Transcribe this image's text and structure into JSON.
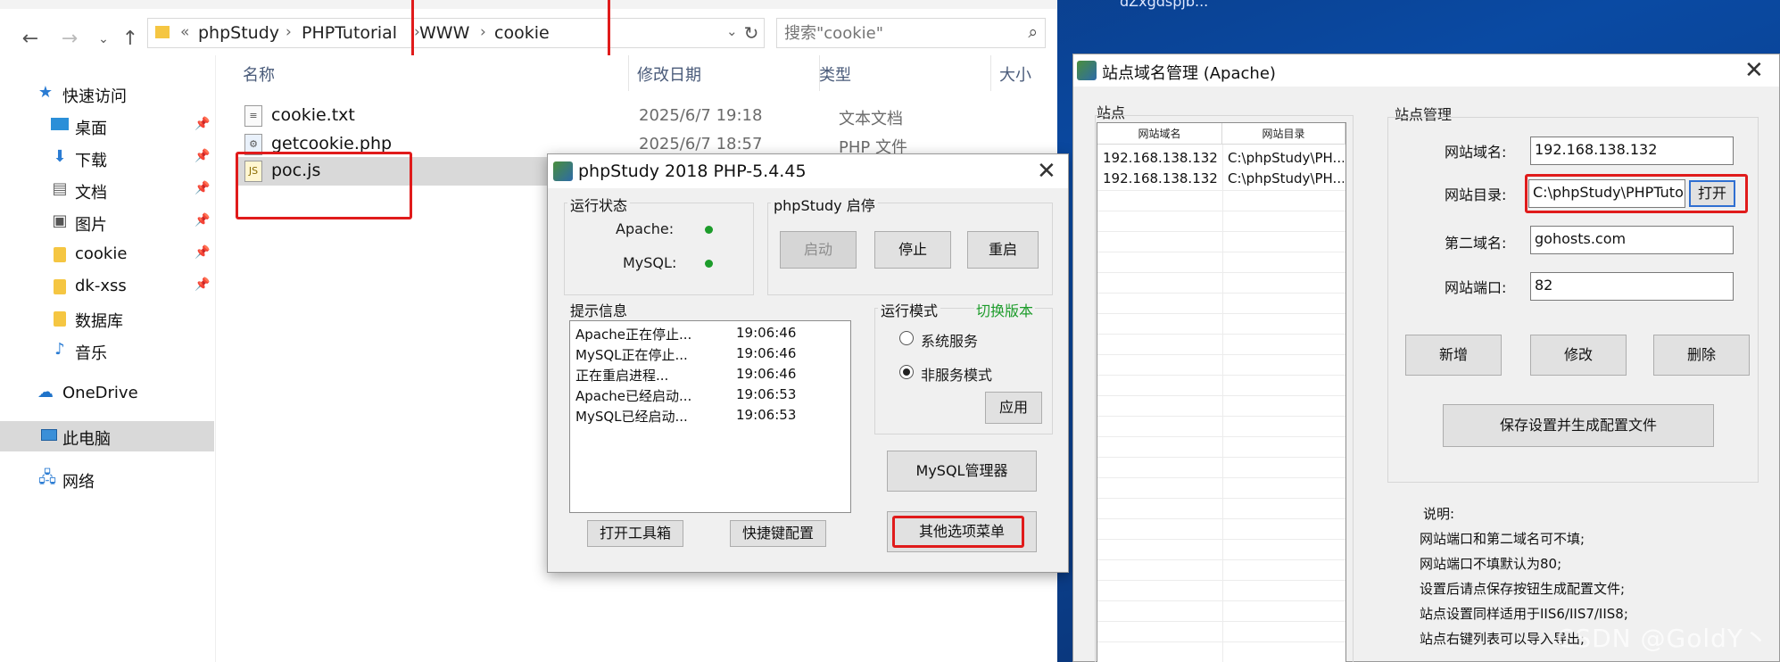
{
  "explorer": {
    "address": {
      "overflow": "«",
      "crumbs": [
        "phpStudy",
        "PHPTutorial",
        "WWW",
        "cookie"
      ]
    },
    "search_placeholder": "搜索\"cookie\"",
    "sidebar": [
      {
        "label": "快速访问",
        "icon": "star-icon",
        "pinned": false
      },
      {
        "label": "桌面",
        "icon": "desktop-icon",
        "pinned": true
      },
      {
        "label": "下载",
        "icon": "download-icon",
        "pinned": true
      },
      {
        "label": "文档",
        "icon": "document-icon",
        "pinned": true
      },
      {
        "label": "图片",
        "icon": "picture-icon",
        "pinned": true
      },
      {
        "label": "cookie",
        "icon": "folder-icon",
        "pinned": true
      },
      {
        "label": "dk-xss",
        "icon": "folder-icon",
        "pinned": true
      },
      {
        "label": "数据库",
        "icon": "folder-icon",
        "pinned": false
      },
      {
        "label": "音乐",
        "icon": "music-icon",
        "pinned": false
      },
      {
        "label": "OneDrive",
        "icon": "cloud-icon",
        "pinned": false
      },
      {
        "label": "此电脑",
        "icon": "computer-icon",
        "pinned": false
      },
      {
        "label": "网络",
        "icon": "network-icon",
        "pinned": false
      }
    ],
    "columns": {
      "name": "名称",
      "date": "修改日期",
      "type": "类型",
      "size": "大小"
    },
    "files": [
      {
        "name": "cookie.txt",
        "date": "2025/6/7 19:18",
        "type": "文本文档",
        "icon": "text-file-icon"
      },
      {
        "name": "getcookie.php",
        "date": "2025/6/7 18:57",
        "type": "PHP 文件",
        "icon": "php-file-icon"
      },
      {
        "name": "poc.js",
        "date": "",
        "type": "",
        "icon": "js-file-icon"
      }
    ]
  },
  "phpstudy": {
    "title": "phpStudy 2018   PHP-5.4.45",
    "status_group": "运行状态",
    "apache_label": "Apache:",
    "mysql_label": "MySQL:",
    "control_group": "phpStudy  启停",
    "start_label": "启动",
    "stop_label": "停止",
    "restart_label": "重启",
    "info_group": "提示信息",
    "info_lines": [
      {
        "text": "Apache正在停止...",
        "time": "19:06:46"
      },
      {
        "text": "MySQL正在停止...",
        "time": "19:06:46"
      },
      {
        "text": "正在重启进程...",
        "time": "19:06:46"
      },
      {
        "text": "Apache已经启动...",
        "time": "19:06:53"
      },
      {
        "text": "MySQL已经启动...",
        "time": "19:06:53"
      }
    ],
    "mode_group": "运行模式",
    "switch_version": "切换版本",
    "mode_system": "系统服务",
    "mode_non_system": "非服务模式",
    "apply_label": "应用",
    "mysql_manager_label": "MySQL管理器",
    "open_tools_label": "打开工具箱",
    "shortcut_label": "快捷键配置",
    "other_menu_label": "其他选项菜单",
    "status_color": "#1d9c2b"
  },
  "sitemgr": {
    "title": "站点域名管理 (Apache)",
    "sites_group": "站点",
    "col_domain": "网站域名",
    "col_dir": "网站目录",
    "rows": [
      {
        "domain": "192.168.138.132",
        "dir": "C:\\phpStudy\\PH..."
      },
      {
        "domain": "192.168.138.132",
        "dir": "C:\\phpStudy\\PH..."
      }
    ],
    "manage_group": "站点管理",
    "domain_label": "网站域名:",
    "domain_value": "192.168.138.132",
    "dir_label": "网站目录:",
    "dir_value": "C:\\phpStudy\\PHPTutor",
    "open_label": "打开",
    "second_label": "第二域名:",
    "second_value": "gohosts.com",
    "port_label": "网站端口:",
    "port_value": "82",
    "add_label": "新增",
    "edit_label": "修改",
    "delete_label": "删除",
    "save_label": "保存设置并生成配置文件",
    "notes": [
      "说明:",
      "网站端口和第二域名可不填;",
      "网站端口不填默认为80;",
      "设置后请点保存按钮生成配置文件;",
      "站点设置同样适用于IIS6/IIS7/IIS8;",
      "站点右键列表可以导入导出;"
    ]
  },
  "desktop_hint": "dZxgdspjb...",
  "watermark": "CSDN @GoldY丶",
  "highlight_color": "#e01b1b"
}
